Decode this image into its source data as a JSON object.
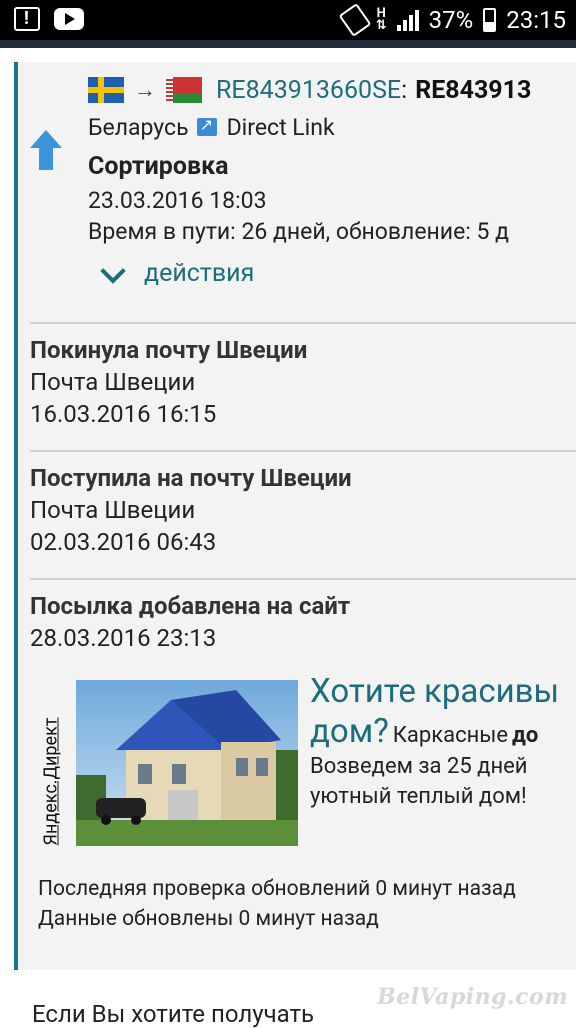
{
  "status_bar": {
    "battery": "37%",
    "time": "23:15",
    "icons": [
      "alert-icon",
      "youtube-icon",
      "rotate-icon",
      "hplus-icon",
      "signal-icon",
      "battery-icon"
    ]
  },
  "tracking": {
    "from_flag": "sweden-flag-icon",
    "to_flag": "belarus-flag-icon",
    "arrow": "→",
    "number_link": "RE843913660SE",
    "colon": ":",
    "number_bold": "RE843913",
    "destination": "Беларусь",
    "direct_link": "Direct Link",
    "status_title": "Сортировка",
    "status_date": "23.03.2016 18:03",
    "transit_info": "Время в пути: 26 дней, обновление: 5 д",
    "actions_label": "действия"
  },
  "events": [
    {
      "title": "Покинула почту Швеции",
      "place": "Почта Швеции",
      "date": "16.03.2016 16:15"
    },
    {
      "title": "Поступила на почту Швеции",
      "place": "Почта Швеции",
      "date": "02.03.2016 06:43"
    },
    {
      "title": "Посылка добавлена на сайт",
      "place": "",
      "date": "28.03.2016 23:13"
    }
  ],
  "ad": {
    "label": "Яндекс.Директ",
    "title_1": "Хотите красивы",
    "title_2": "дом?",
    "body_1": "Каркасные",
    "body_1_bold": "до",
    "body_2": "Возведем за 25 дней",
    "body_3": "уютный теплый дом!"
  },
  "footer": {
    "last_check": "Последняя проверка обновлений 0 минут назад",
    "data_updated": "Данные обновлены 0 минут назад"
  },
  "bottom_text": "Если Вы хотите получать",
  "watermark": "BelVaping.com",
  "colors": {
    "accent": "#1e6d7d",
    "card_border": "#147a8a",
    "card_bg": "#f3f3f3"
  }
}
